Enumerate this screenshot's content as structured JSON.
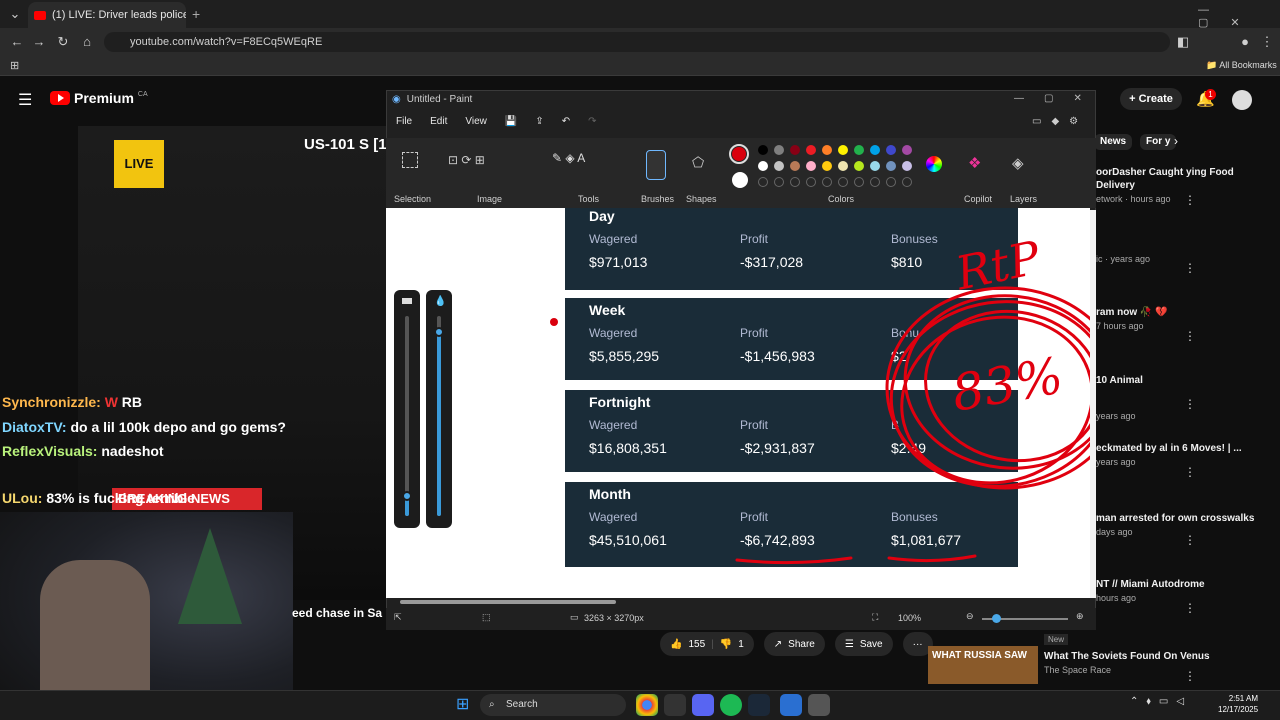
{
  "browser": {
    "tab_title": "(1) LIVE: Driver leads police on",
    "tab_close": "✕",
    "new_tab": "+",
    "url": "youtube.com/watch?v=F8ECq5WEqRE",
    "all_bookmarks": "All Bookmarks"
  },
  "youtube": {
    "logo": "Premium",
    "country": "CA",
    "create_label": "Create",
    "notification_count": "1",
    "live_badge": "LIVE",
    "highway_text": "US-101 S [1",
    "video_title_fragment": "eed chase in Sa",
    "likes": "155",
    "dislikes": "1",
    "share_label": "Share",
    "save_label": "Save",
    "more": "···",
    "chips": [
      "News",
      "For y"
    ]
  },
  "chat": [
    {
      "user": "Synchronizzle:",
      "msg": "RB",
      "color": "#ffb84d"
    },
    {
      "user": "DiatoxTV:",
      "msg": "do a lil 100k depo and go gems?",
      "color": "#7fd6ff"
    },
    {
      "user": "ReflexVisuals:",
      "msg": "nadeshot",
      "color": "#b9f27c"
    },
    {
      "user": "ULou:",
      "msg": "83% is fucking terrible",
      "color": "#f5d76e"
    }
  ],
  "breaking_news": "BREAKING NEWS",
  "sidebar_videos": [
    {
      "title": "oorDasher Caught ying Food Delivery",
      "meta": "etwork · hours ago"
    },
    {
      "title": "",
      "meta": "ic · years ago"
    },
    {
      "title": "ram now 🥀 💔",
      "meta": "7 hours ago"
    },
    {
      "title": "10 Animal",
      "meta": "years ago"
    },
    {
      "title": "eckmated by al in 6 Moves! | ...",
      "meta": "years ago"
    },
    {
      "title": "man arrested for own crosswalks",
      "meta": "days ago"
    },
    {
      "title": "NT // Miami Autodrome",
      "meta": "hours ago"
    },
    {
      "title": "What The Soviets Found On Venus",
      "meta": "The Space Race"
    }
  ],
  "sidebar_badges": {
    "new": "New",
    "thumb_text": "WHAT RUSSIA SAW"
  },
  "paint": {
    "title": "Untitled - Paint",
    "menu": [
      "File",
      "Edit",
      "View"
    ],
    "groups": [
      "Selection",
      "Image",
      "Tools",
      "Brushes",
      "Shapes",
      "Colors",
      "Copilot",
      "Layers"
    ],
    "dimensions": "3263 × 3270px",
    "zoom": "100%",
    "primary_color": "#d9000d",
    "secondary_color": "#ffffff",
    "palette": [
      "#000000",
      "#7f7f7f",
      "#880015",
      "#ed1c24",
      "#ff7f27",
      "#fff200",
      "#22b14c",
      "#00a2e8",
      "#3f48cc",
      "#a349a4",
      "#ffffff",
      "#c3c3c3",
      "#b97a57",
      "#ffaec9",
      "#ffc90e",
      "#efe4b0",
      "#b5e61d",
      "#99d9ea",
      "#7092be",
      "#c8bfe7"
    ],
    "slider_size_level": 0.1,
    "slider_opacity_level": 0.92
  },
  "stats": {
    "periods": [
      {
        "name": "Day",
        "wagered_label": "Wagered",
        "wagered": "$971,013",
        "profit_label": "Profit",
        "profit": "-$317,028",
        "bonus_label": "Bonuses",
        "bonus": "$810"
      },
      {
        "name": "Week",
        "wagered_label": "Wagered",
        "wagered": "$5,855,295",
        "profit_label": "Profit",
        "profit": "-$1,456,983",
        "bonus_label": "Bonu",
        "bonus": "$2"
      },
      {
        "name": "Fortnight",
        "wagered_label": "Wagered",
        "wagered": "$16,808,351",
        "profit_label": "Profit",
        "profit": "-$2,931,837",
        "bonus_label": "B",
        "bonus": "$2.49"
      },
      {
        "name": "Month",
        "wagered_label": "Wagered",
        "wagered": "$45,510,061",
        "profit_label": "Profit",
        "profit": "-$6,742,893",
        "bonus_label": "Bonuses",
        "bonus": "$1,081,677"
      }
    ],
    "annotation_rtp": "RtP",
    "annotation_pct": "83%"
  },
  "taskbar": {
    "search": "Search",
    "time": "2:51 AM",
    "date": "12/17/2025"
  }
}
